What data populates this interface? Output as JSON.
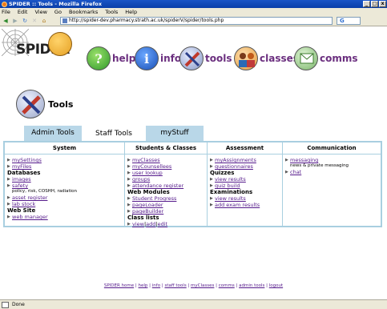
{
  "window": {
    "title": "SPIDER :: Tools - Mozilla Firefox",
    "min": "_",
    "max": "□",
    "close": "x"
  },
  "menu": [
    "File",
    "Edit",
    "View",
    "Go",
    "Bookmarks",
    "Tools",
    "Help"
  ],
  "toolbar": {
    "url": "http://spider-dev.pharmacy.strath.ac.uk/spiderV/spider/tools.php",
    "go_glyph": "G"
  },
  "logo": {
    "text": "SPIDER"
  },
  "topnav": [
    {
      "label": "help",
      "icon": "help-icon",
      "glyph": "?"
    },
    {
      "label": "info",
      "icon": "info-icon",
      "glyph": "i"
    },
    {
      "label": "tools",
      "icon": "tools-icon",
      "glyph": ""
    },
    {
      "label": "classes",
      "icon": "classes-icon",
      "glyph": ""
    },
    {
      "label": "comms",
      "icon": "comms-icon",
      "glyph": ""
    }
  ],
  "page": {
    "title": "Tools"
  },
  "tabs": [
    {
      "label": "Admin Tools",
      "active": false
    },
    {
      "label": "Staff Tools",
      "active": true
    },
    {
      "label": "myStuff",
      "active": false
    }
  ],
  "columns": {
    "system": {
      "header": "System",
      "items": [
        {
          "type": "link",
          "text": "mySettings"
        },
        {
          "type": "link",
          "text": "myFiles"
        },
        {
          "type": "sub",
          "text": "Databases"
        },
        {
          "type": "link",
          "text": "images"
        },
        {
          "type": "link",
          "text": "safety"
        },
        {
          "type": "note",
          "text": "policy, risk, COSHH, radiation"
        },
        {
          "type": "link",
          "text": "asset register"
        },
        {
          "type": "link",
          "text": "lab stock"
        },
        {
          "type": "sub",
          "text": "Web Site"
        },
        {
          "type": "link",
          "text": "web manager"
        }
      ]
    },
    "students": {
      "header": "Students & Classes",
      "items": [
        {
          "type": "link",
          "text": "myClasses"
        },
        {
          "type": "link",
          "text": "myCounsellees"
        },
        {
          "type": "link",
          "text": "user lookup"
        },
        {
          "type": "link",
          "text": "groups"
        },
        {
          "type": "link",
          "text": "attendance register"
        },
        {
          "type": "sub",
          "text": "Web Modules"
        },
        {
          "type": "link",
          "text": "Student Progress"
        },
        {
          "type": "link",
          "text": "pageLoader"
        },
        {
          "type": "link",
          "text": "pageBuilder"
        },
        {
          "type": "sub",
          "text": "Class lists"
        }
      ],
      "classlists": [
        "view",
        "add",
        "edit"
      ]
    },
    "assessment": {
      "header": "Assessment",
      "items": [
        {
          "type": "link",
          "text": "myAssignments"
        },
        {
          "type": "link",
          "text": "questionnaires"
        },
        {
          "type": "sub",
          "text": "Quizzes"
        },
        {
          "type": "link",
          "text": "view results"
        },
        {
          "type": "link",
          "text": "quiz build"
        },
        {
          "type": "sub",
          "text": "Examinations"
        },
        {
          "type": "link",
          "text": "view results"
        },
        {
          "type": "link",
          "text": "add exam results"
        }
      ]
    },
    "communication": {
      "header": "Communication",
      "items": [
        {
          "type": "link",
          "text": "messaging"
        },
        {
          "type": "note",
          "text": "news & private messaging"
        },
        {
          "type": "link",
          "text": "chat"
        }
      ]
    }
  },
  "footer": [
    "SPIDER home",
    "help",
    "info",
    "staff tools",
    "myClasses",
    "comms",
    "admin tools",
    "logout"
  ],
  "status": {
    "text": "Done"
  },
  "colors": {
    "link": "#551a8b",
    "tab_inactive": "#b9d7e8",
    "panel_border": "#a9cfe0",
    "nav_label": "#6b2f7f"
  }
}
